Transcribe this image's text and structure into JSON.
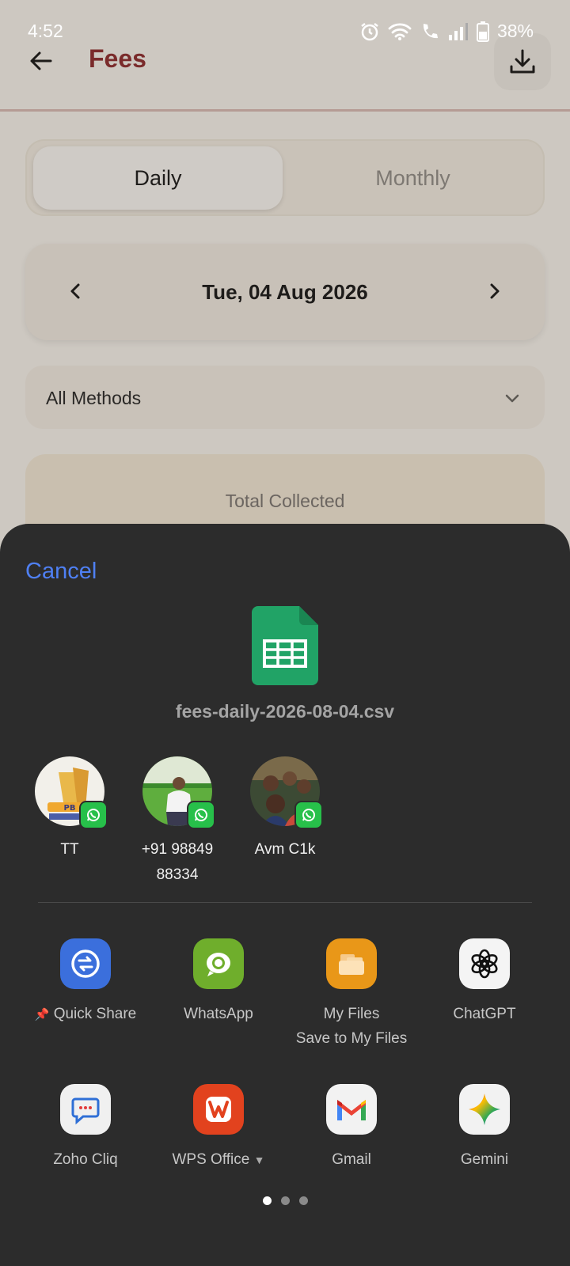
{
  "status": {
    "time": "4:52",
    "battery": "38%"
  },
  "header": {
    "title": "Fees"
  },
  "tabs": {
    "daily": "Daily",
    "monthly": "Monthly"
  },
  "date": {
    "label": "Tue, 04 Aug 2026"
  },
  "filter": {
    "method": "All Methods"
  },
  "summary": {
    "total_label": "Total Collected"
  },
  "share": {
    "cancel": "Cancel",
    "file_name": "fees-daily-2026-08-04.csv",
    "contacts": [
      {
        "name": "TT"
      },
      {
        "name_line1": "+91 98849",
        "name_line2": "88334"
      },
      {
        "name": "Avm C1k"
      }
    ],
    "apps": [
      {
        "label": "Quick Share",
        "icon": "quick-share-icon"
      },
      {
        "label": "WhatsApp",
        "icon": "whatsapp-icon"
      },
      {
        "label": "My Files",
        "sublabel": "Save to My Files",
        "icon": "folder-icon"
      },
      {
        "label": "ChatGPT",
        "icon": "chatgpt-icon"
      },
      {
        "label": "Zoho Cliq",
        "icon": "chat-bubble-icon"
      },
      {
        "label": "WPS Office",
        "icon": "wps-icon"
      },
      {
        "label": "Gmail",
        "icon": "gmail-icon"
      },
      {
        "label": "Gemini",
        "icon": "gemini-icon"
      }
    ],
    "page_count": 3,
    "current_page": 1
  },
  "colors": {
    "accent_blue": "#4f80f4",
    "title_red": "#7a2b2b",
    "sheet_bg": "#2c2c2c",
    "sheets_green": "#21a366",
    "whatsapp_green": "#27c04a"
  }
}
